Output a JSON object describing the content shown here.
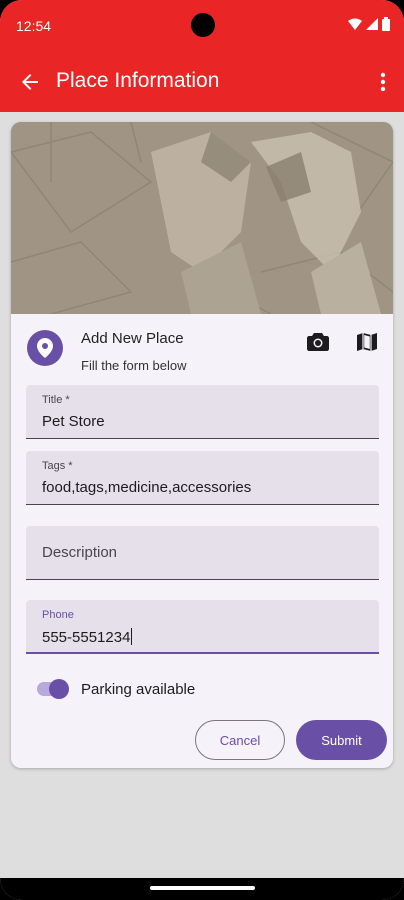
{
  "status_bar": {
    "time": "12:54"
  },
  "app_bar": {
    "title": "Place Information"
  },
  "form": {
    "title": "Add New Place",
    "subtitle": "Fill the form below",
    "fields": {
      "title": {
        "label": "Title *",
        "value": "Pet Store"
      },
      "tags": {
        "label": "Tags *",
        "value": "food,tags,medicine,accessories"
      },
      "description": {
        "placeholder": "Description",
        "value": ""
      },
      "phone": {
        "label": "Phone",
        "value": "555-5551234"
      }
    },
    "parking": {
      "label": "Parking available",
      "checked": true
    },
    "cancel_label": "Cancel",
    "submit_label": "Submit"
  },
  "colors": {
    "app_bar": "#e92525",
    "accent": "#6a4fa7",
    "field_bg": "#e6e0ea",
    "card_bg": "#f6f2f9"
  },
  "icons": {
    "back": "arrow-back-icon",
    "more": "more-vert-icon",
    "location": "location-pin-icon",
    "camera": "camera-icon",
    "map": "map-icon"
  }
}
